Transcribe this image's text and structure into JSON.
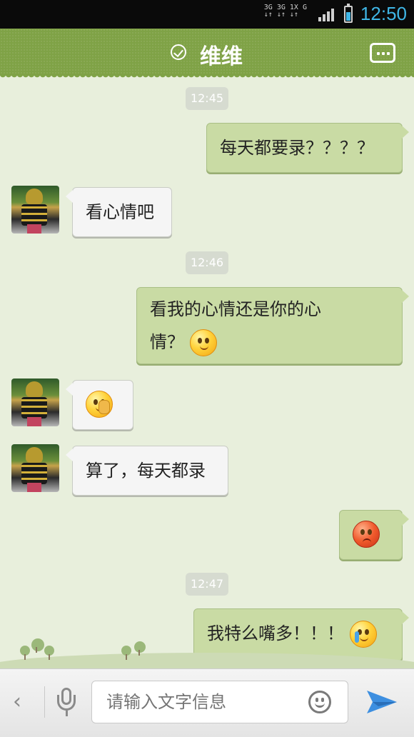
{
  "status_bar": {
    "network_top": "3G 3G 1X G",
    "network_bottom": "↓↑ ↓↑ ↓↑",
    "time": "12:50",
    "accent_color": "#3fb6e6"
  },
  "header": {
    "title": "维维",
    "verified_icon": "check-circle-icon",
    "menu_icon": "chat-menu-icon",
    "bg_color": "#7fa246"
  },
  "messages": [
    {
      "type": "timestamp",
      "text": "12:45"
    },
    {
      "type": "outgoing",
      "text": "每天都要录？？？？"
    },
    {
      "type": "incoming",
      "text": "看心情吧"
    },
    {
      "type": "timestamp",
      "text": "12:46"
    },
    {
      "type": "outgoing",
      "line1": "看我的心情还是你的心",
      "line2": "情？",
      "emoji": "sweat-emoji"
    },
    {
      "type": "incoming",
      "emoji": "facepalm-emoji"
    },
    {
      "type": "incoming",
      "text": "算了，每天都录"
    },
    {
      "type": "outgoing",
      "emoji": "angry-emoji"
    },
    {
      "type": "timestamp",
      "text": "12:47"
    },
    {
      "type": "outgoing",
      "text": "我特么嘴多！！！",
      "emoji": "crying-emoji"
    }
  ],
  "input_bar": {
    "back_icon": "chevron-left-icon",
    "mic_icon": "microphone-icon",
    "placeholder": "请输入文字信息",
    "emoji_icon": "smiley-icon",
    "send_icon": "send-icon"
  },
  "colors": {
    "chat_bg": "#e8efdc",
    "outgoing_bubble": "#c9dba4",
    "incoming_bubble": "#f5f5f5"
  }
}
